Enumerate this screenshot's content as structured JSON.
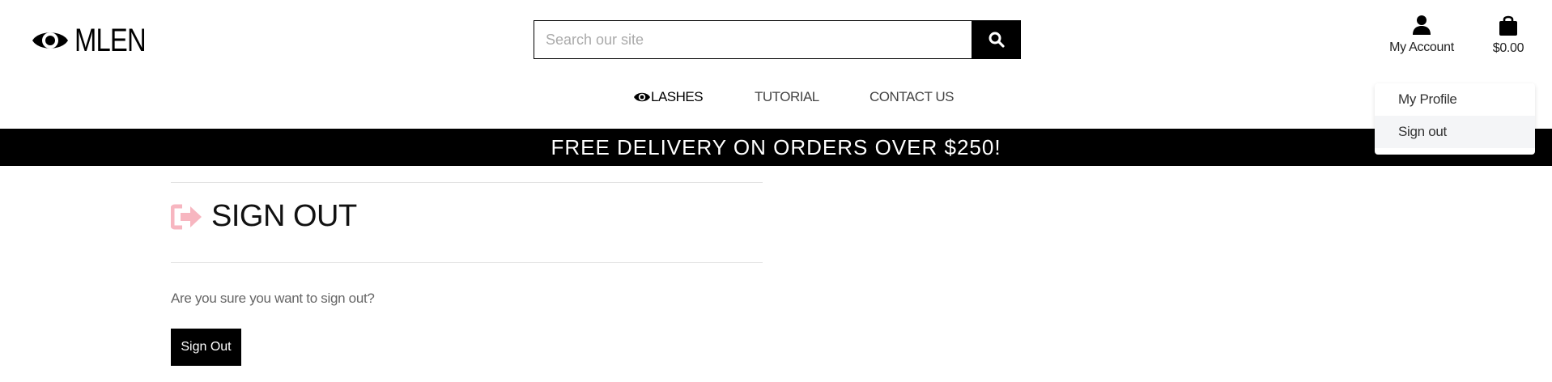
{
  "brand": {
    "name": "MLEN",
    "icon": "eye-icon"
  },
  "search": {
    "placeholder": "Search our site",
    "value": "",
    "button_icon": "search-icon"
  },
  "account": {
    "label": "My Account",
    "icon": "user-icon"
  },
  "cart": {
    "total": "$0.00",
    "icon": "shopping-bag-icon"
  },
  "dropdown": {
    "items": [
      {
        "label": "My Profile"
      },
      {
        "label": "Sign out"
      }
    ]
  },
  "nav": {
    "items": [
      {
        "label": "LASHES",
        "icon": "eye-icon"
      },
      {
        "label": "TUTORIAL"
      },
      {
        "label": "CONTACT US"
      }
    ]
  },
  "banner": {
    "text": "FREE DELIVERY ON ORDERS OVER $250!"
  },
  "main": {
    "title": "SIGN OUT",
    "title_icon": "sign-out-arrow-icon",
    "question": "Are you sure you want to sign out?",
    "button_label": "Sign Out"
  },
  "colors": {
    "accent": "#f7b6c0",
    "banner_bg": "#000000",
    "button_bg": "#000000"
  }
}
